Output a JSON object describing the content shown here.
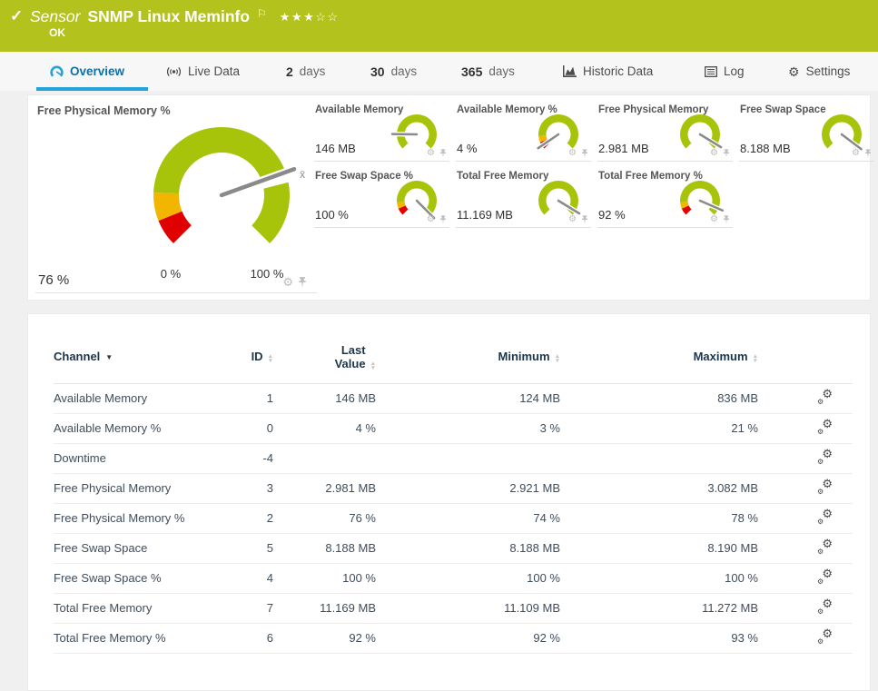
{
  "header": {
    "status_icon": "check-icon",
    "kind_label": "Sensor",
    "title": "SNMP Linux Meminfo",
    "flag_icon": "flag-icon",
    "rating_filled": 3,
    "rating_total": 5,
    "status": "OK"
  },
  "tabs": [
    {
      "label": "Overview",
      "icon": "gauge-icon",
      "active": true
    },
    {
      "label": "Live Data",
      "icon": "live-data-icon"
    },
    {
      "num": "2",
      "label": "days"
    },
    {
      "num": "30",
      "label": "days"
    },
    {
      "num": "365",
      "label": "days"
    },
    {
      "label": "Historic Data",
      "icon": "historic-chart-icon"
    },
    {
      "label": "Log",
      "icon": "log-icon"
    },
    {
      "label": "Settings",
      "icon": "settings-gear-icon"
    }
  ],
  "gauges": {
    "main": {
      "title": "Free Physical Memory %",
      "value_label": "76 %",
      "value_fraction": 0.76,
      "average_fraction": 0.78,
      "average_marker": "x̄",
      "scale_min_label": "0 %",
      "scale_max_label": "100 %",
      "segments": [
        {
          "color": "red",
          "from": 0,
          "to": 0.085
        },
        {
          "color": "yellow",
          "from": 0.085,
          "to": 0.175
        },
        {
          "color": "green",
          "from": 0.175,
          "to": 1
        }
      ]
    },
    "minis": [
      {
        "title": "Available Memory",
        "value_label": "146 MB",
        "value_fraction": 0.17,
        "segments": [
          {
            "color": "green",
            "from": 0,
            "to": 1
          }
        ]
      },
      {
        "title": "Available Memory %",
        "value_label": "4 %",
        "value_fraction": 0.04,
        "segments": [
          {
            "color": "red",
            "from": 0,
            "to": 0.08
          },
          {
            "color": "yellow",
            "from": 0.08,
            "to": 0.15
          },
          {
            "color": "green",
            "from": 0.15,
            "to": 1
          }
        ]
      },
      {
        "title": "Free Physical Memory",
        "value_label": "2.981 MB",
        "value_fraction": 0.95,
        "segments": [
          {
            "color": "green",
            "from": 0,
            "to": 1
          }
        ]
      },
      {
        "title": "Free Swap Space",
        "value_label": "8.188 MB",
        "value_fraction": 0.97,
        "segments": [
          {
            "color": "green",
            "from": 0,
            "to": 1
          }
        ]
      },
      {
        "title": "Free Swap Space %",
        "value_label": "100 %",
        "value_fraction": 1,
        "segments": [
          {
            "color": "red",
            "from": 0,
            "to": 0.08
          },
          {
            "color": "yellow",
            "from": 0.08,
            "to": 0.15
          },
          {
            "color": "green",
            "from": 0.15,
            "to": 1
          }
        ]
      },
      {
        "title": "Total Free Memory",
        "value_label": "11.169 MB",
        "value_fraction": 0.95,
        "segments": [
          {
            "color": "green",
            "from": 0,
            "to": 1
          }
        ]
      },
      {
        "title": "Total Free Memory %",
        "value_label": "92 %",
        "value_fraction": 0.92,
        "segments": [
          {
            "color": "red",
            "from": 0,
            "to": 0.08
          },
          {
            "color": "yellow",
            "from": 0.08,
            "to": 0.15
          },
          {
            "color": "green",
            "from": 0.15,
            "to": 1
          }
        ]
      }
    ],
    "panel_icons": [
      "gear-icon",
      "pin-icon"
    ]
  },
  "table": {
    "columns": [
      {
        "label": "Channel",
        "sort": "active-desc"
      },
      {
        "label": "ID",
        "sort": "none"
      },
      {
        "label": "Last Value",
        "sort": "none"
      },
      {
        "label": "Minimum",
        "sort": "none"
      },
      {
        "label": "Maximum",
        "sort": "none"
      }
    ],
    "row_action_icon": "edit-channel-gears-icon",
    "rows": [
      {
        "channel": "Available Memory",
        "id": "1",
        "last": "146 MB",
        "min": "124 MB",
        "max": "836 MB"
      },
      {
        "channel": "Available Memory %",
        "id": "0",
        "last": "4 %",
        "min": "3 %",
        "max": "21 %"
      },
      {
        "channel": "Downtime",
        "id": "-4",
        "last": "",
        "min": "",
        "max": ""
      },
      {
        "channel": "Free Physical Memory",
        "id": "3",
        "last": "2.981 MB",
        "min": "2.921 MB",
        "max": "3.082 MB"
      },
      {
        "channel": "Free Physical Memory %",
        "id": "2",
        "last": "76 %",
        "min": "74 %",
        "max": "78 %"
      },
      {
        "channel": "Free Swap Space",
        "id": "5",
        "last": "8.188 MB",
        "min": "8.188 MB",
        "max": "8.190 MB"
      },
      {
        "channel": "Free Swap Space %",
        "id": "4",
        "last": "100 %",
        "min": "100 %",
        "max": "100 %"
      },
      {
        "channel": "Total Free Memory",
        "id": "7",
        "last": "11.169 MB",
        "min": "11.109 MB",
        "max": "11.272 MB"
      },
      {
        "channel": "Total Free Memory %",
        "id": "6",
        "last": "92 %",
        "min": "92 %",
        "max": "93 %"
      }
    ]
  },
  "colors": {
    "header_green": "#b4c21d",
    "gauge_green": "#a8c40a",
    "gauge_yellow": "#f2b600",
    "gauge_red": "#e10000",
    "needle_gray": "#8a8a8a",
    "accent_blue": "#25a2d9",
    "active_tab_text": "#0f6fa6",
    "table_header_text": "#1d3549",
    "page_bg": "#f0f0f0"
  }
}
